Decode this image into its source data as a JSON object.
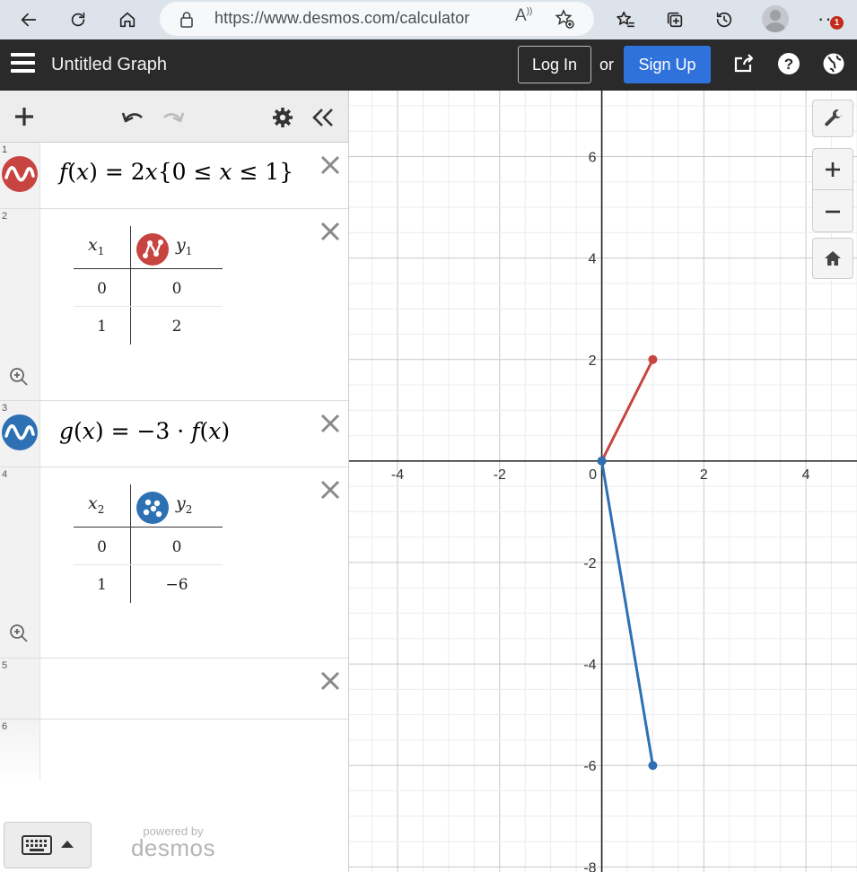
{
  "browser": {
    "url": "https://www.desmos.com/calculator",
    "notification_count": "1"
  },
  "header": {
    "title": "Untitled Graph",
    "login_label": "Log In",
    "or_label": "or",
    "signup_label": "Sign Up",
    "accent_color": "#2f72dc"
  },
  "expressions": [
    {
      "num": "1",
      "type": "expression",
      "color": "#c74440",
      "latex": "f(x) = 2x{0 ≤ x ≤ 1}"
    },
    {
      "num": "2",
      "type": "table",
      "color": "#c74440",
      "headers": [
        "x1",
        "y1"
      ],
      "rows": [
        [
          "0",
          "0"
        ],
        [
          "1",
          "2"
        ]
      ]
    },
    {
      "num": "3",
      "type": "expression",
      "color": "#2d70b3",
      "latex": "g(x) = −3 · f(x)"
    },
    {
      "num": "4",
      "type": "table",
      "color": "#2d70b3",
      "headers": [
        "x2",
        "y2"
      ],
      "rows": [
        [
          "0",
          "0"
        ],
        [
          "1",
          "−6"
        ]
      ]
    },
    {
      "num": "5",
      "type": "empty"
    },
    {
      "num": "6",
      "type": "empty"
    }
  ],
  "powered_by": {
    "small": "powered by",
    "brand": "desmos"
  },
  "chart_data": {
    "type": "line",
    "xlim": [
      -4.95,
      5.0
    ],
    "ylim": [
      -8.1,
      7.3
    ],
    "grid": true,
    "x_ticks": [
      "-4",
      "-2",
      "0",
      "2",
      "4"
    ],
    "y_ticks": [
      "6",
      "4",
      "2",
      "-2",
      "-4",
      "-6",
      "-8"
    ],
    "series": [
      {
        "color": "#c74440",
        "x": [
          0,
          1
        ],
        "y": [
          0,
          2
        ]
      },
      {
        "color": "#2d70b3",
        "x": [
          0,
          1
        ],
        "y": [
          0,
          -6
        ]
      }
    ]
  }
}
